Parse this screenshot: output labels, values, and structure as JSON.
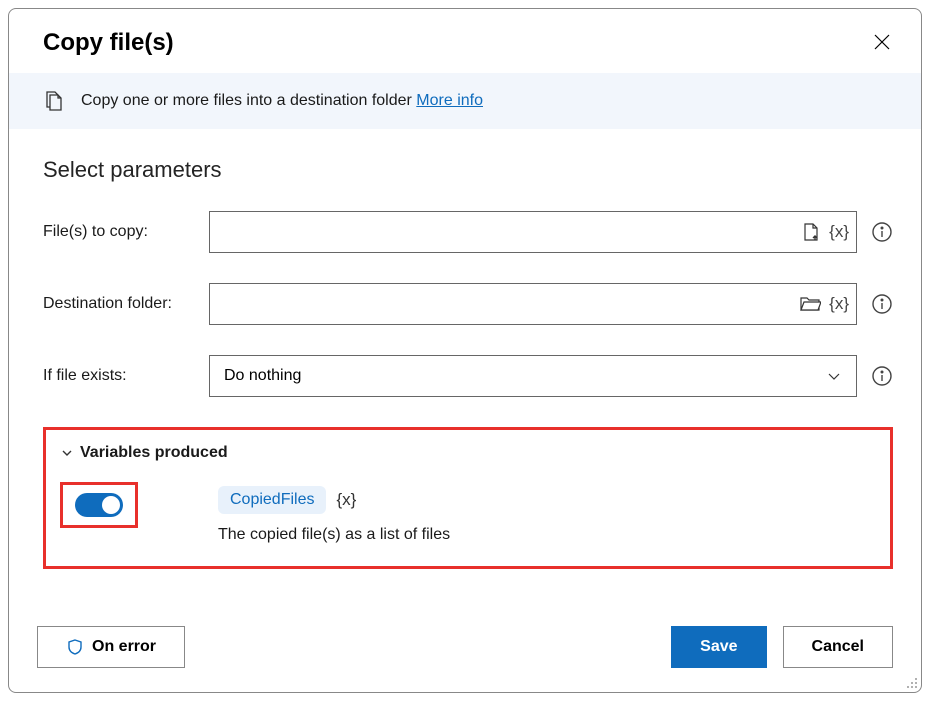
{
  "header": {
    "title": "Copy file(s)"
  },
  "banner": {
    "text": "Copy one or more files into a destination folder ",
    "link_label": "More info"
  },
  "section_heading": "Select parameters",
  "fields": {
    "files_to_copy": {
      "label": "File(s) to copy:",
      "value": ""
    },
    "destination_folder": {
      "label": "Destination folder:",
      "value": ""
    },
    "if_file_exists": {
      "label": "If file exists:",
      "selected": "Do nothing"
    }
  },
  "variables": {
    "header": "Variables produced",
    "toggle_on": true,
    "name": "CopiedFiles",
    "expr": "{x}",
    "description": "The copied file(s) as a list of files"
  },
  "footer": {
    "on_error": "On error",
    "save": "Save",
    "cancel": "Cancel"
  }
}
